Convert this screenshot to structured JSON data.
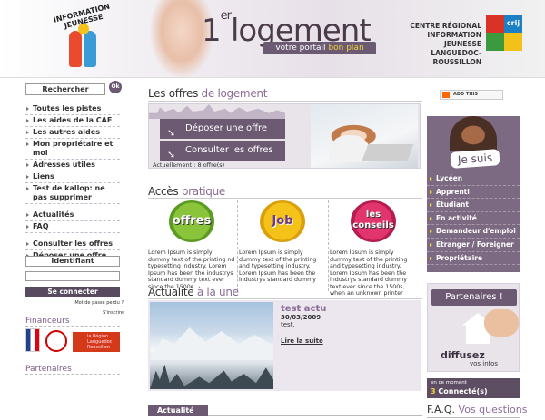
{
  "header": {
    "logo_text": "INFORMATION JEUNESSE",
    "title_prefix": "1",
    "title_sup": "er",
    "title": "logement",
    "tagline_main": "votre portail",
    "tagline_accent": "bon plan",
    "crij_line1": "CENTRE RÉGIONAL",
    "crij_line2": "INFORMATION JEUNESSE",
    "crij_line3": "LANGUEDOC-ROUSSILLON",
    "crij_logo_text": "crij",
    "colors": {
      "purple": "#6b5a72",
      "accent": "#f2d43a",
      "red": "#e94b2e",
      "blue": "#3a9bd6"
    }
  },
  "search": {
    "button_label": "Rechercher",
    "ok_label": "Ok"
  },
  "left_nav": {
    "items": [
      {
        "label": "Toutes les pistes"
      },
      {
        "label": "Les aides de la CAF"
      },
      {
        "label": "Les autres aides"
      },
      {
        "label": "Mon propriétaire et moi"
      },
      {
        "label": "Adresses utiles"
      },
      {
        "label": "Liens"
      },
      {
        "label": "Test de kallop: ne pas supprimer"
      },
      {
        "label": "Actualités"
      },
      {
        "label": "FAQ"
      },
      {
        "label": "Consulter les offres"
      },
      {
        "label": "Déposer une offre"
      }
    ]
  },
  "login": {
    "title": "Identifiant",
    "connect_label": "Se connecter",
    "forgot_label": "Mot de passe perdu ?",
    "register_label": "S'inscrire"
  },
  "financeurs": {
    "title": "Financeurs",
    "region_text": "la Région Languedoc Roussillon"
  },
  "partenaires_left": {
    "title": "Partenaires"
  },
  "offres": {
    "heading_plain": "Les offres",
    "heading_accent": "de logement",
    "deposit_label": "Déposer une offre",
    "consult_label": "Consulter les offres",
    "count_text": "Actuellement : 8 offre(s)"
  },
  "acces": {
    "heading_plain": "Accès",
    "heading_accent": "pratique",
    "items": [
      {
        "badge": "offres",
        "text": "Lorem Ipsum is simply dummy text of the printing nd typesetting industry. Lorem Ipsum has been the industrys standard dummy text ever since the 1500s"
      },
      {
        "badge": "Job",
        "text": "Lorem Ipsum is simply dummy text of the printing and typesetting industry. Lorem Ipsum has been the industrys standard dummy"
      },
      {
        "badge": "les conseils",
        "text": "Lorem Ipsum is simply dummy text of the printing and typesetting industry. Lorem Ipsum has been the industrys standard dummy text ever since the 1500s, when an unknown printer"
      }
    ]
  },
  "actualite": {
    "heading_plain": "Actualité",
    "heading_accent": "à la une",
    "title": "test actu",
    "date": "30/03/2009",
    "summary": "test.",
    "link_label": "Lire la suite",
    "tab_label": "Actualité"
  },
  "addthis": {
    "label": "ADD THIS"
  },
  "jesuis": {
    "title": "Je suis",
    "items": [
      {
        "label": "Lycéen"
      },
      {
        "label": "Apprenti"
      },
      {
        "label": "Étudiant"
      },
      {
        "label": "En activité"
      },
      {
        "label": "Demandeur d'emploi"
      },
      {
        "label": "Etranger / Foreigner"
      },
      {
        "label": "Propriétaire"
      }
    ]
  },
  "partners_box": {
    "title": "Partenaires !",
    "line1": "diffusez",
    "line2": "vos infos"
  },
  "online": {
    "label": "en ce moment",
    "count": "3",
    "suffix": "Connecté(s)"
  },
  "faq": {
    "plain": "F.A.Q.",
    "accent": "Vos questions"
  }
}
